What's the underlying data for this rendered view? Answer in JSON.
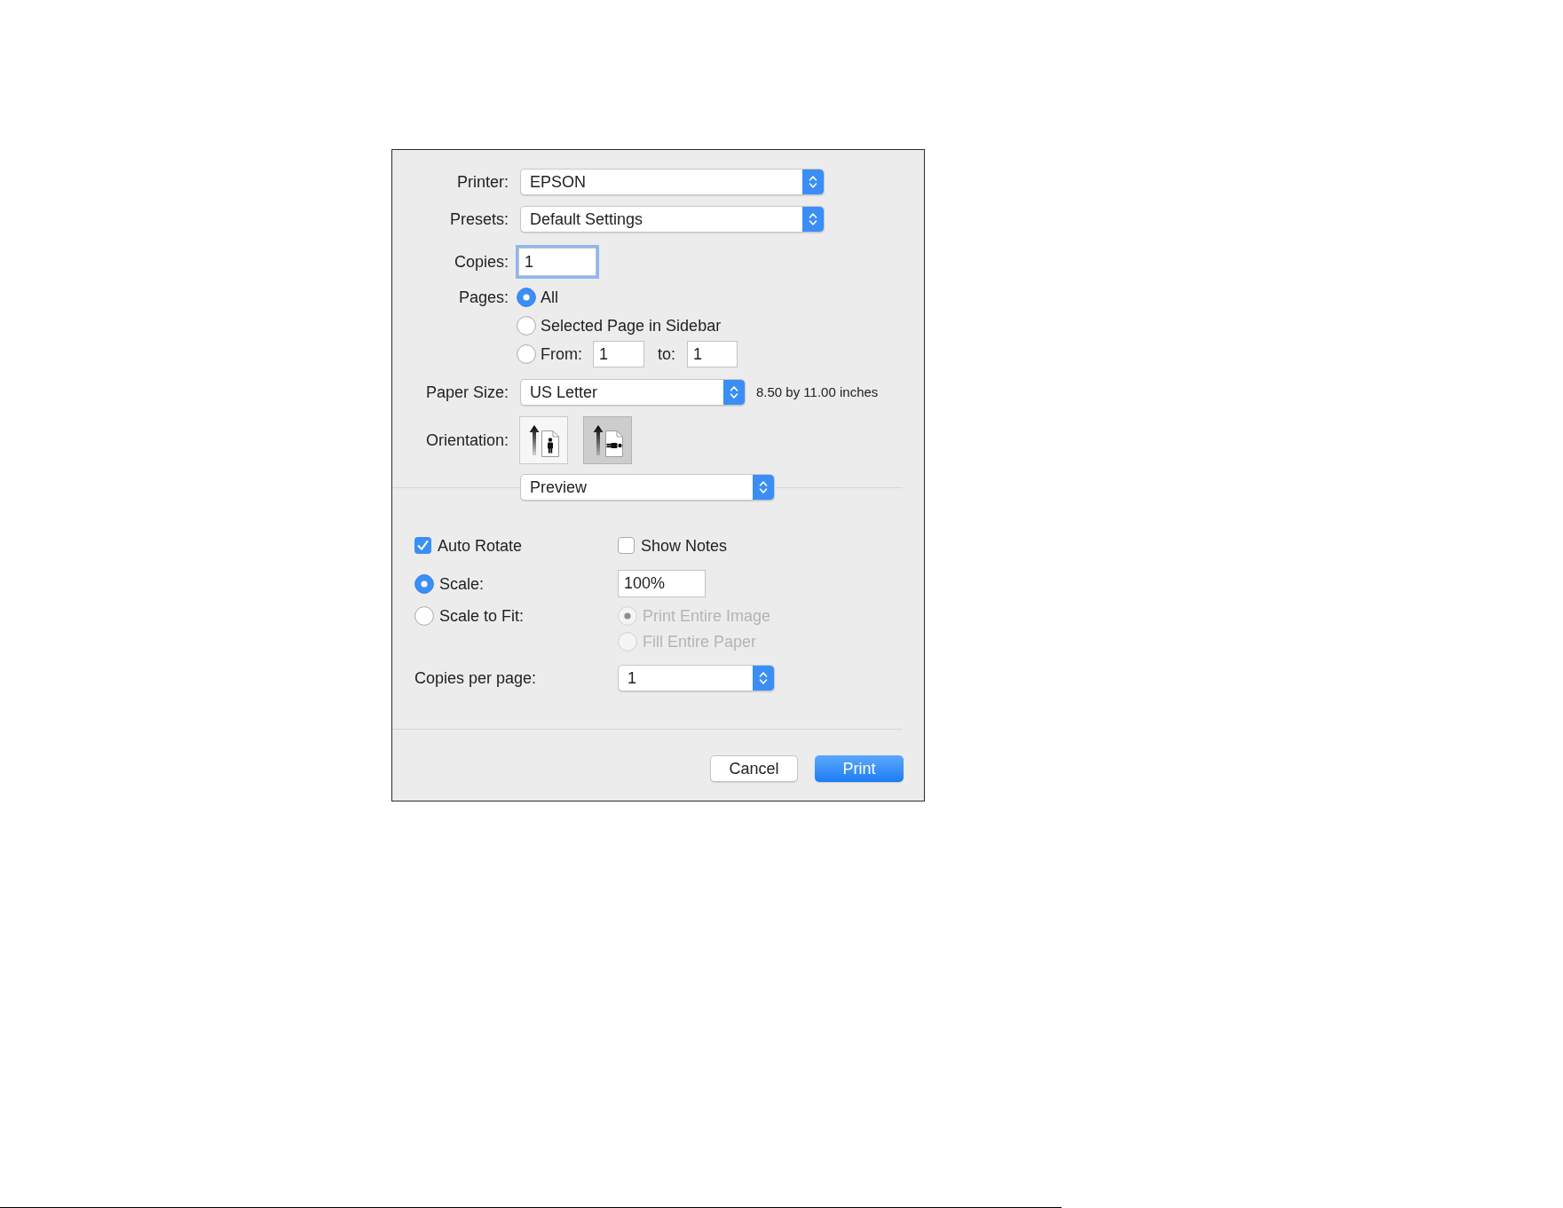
{
  "printer": {
    "label": "Printer:",
    "value": "EPSON"
  },
  "presets": {
    "label": "Presets:",
    "value": "Default Settings"
  },
  "copies": {
    "label": "Copies:",
    "value": "1",
    "focused": true
  },
  "pages": {
    "label": "Pages:",
    "options": [
      {
        "kind": "plain",
        "label": "All",
        "selected": true
      },
      {
        "kind": "plain",
        "label": "Selected Page in Sidebar",
        "selected": false
      },
      {
        "kind": "range",
        "label": "From:",
        "from": "1",
        "to_label": "to:",
        "to": "1",
        "selected": false
      }
    ]
  },
  "paper_size": {
    "label": "Paper Size:",
    "value": "US Letter",
    "dimensions": "8.50 by 11.00 inches"
  },
  "orientation": {
    "label": "Orientation:",
    "options": [
      {
        "kind": "portrait",
        "selected": false
      },
      {
        "kind": "landscape",
        "selected": true
      }
    ]
  },
  "section_menu": {
    "value": "Preview"
  },
  "preview_options": {
    "checkboxes": [
      {
        "label": "Auto Rotate",
        "checked": true
      },
      {
        "label": "Show Notes",
        "checked": false
      }
    ],
    "scale_modes": [
      {
        "kind": "value",
        "label": "Scale:",
        "selected": true,
        "value": "100%"
      },
      {
        "kind": "fit",
        "label": "Scale to Fit:",
        "selected": false,
        "choices": [
          {
            "label": "Print Entire Image",
            "selected": true,
            "disabled": true
          },
          {
            "label": "Fill Entire Paper",
            "selected": false,
            "disabled": true
          }
        ]
      }
    ],
    "copies_per_page": {
      "label": "Copies per page:",
      "value": "1"
    }
  },
  "buttons": [
    {
      "label": "Cancel",
      "kind": "default"
    },
    {
      "label": "Print",
      "kind": "primary"
    }
  ]
}
